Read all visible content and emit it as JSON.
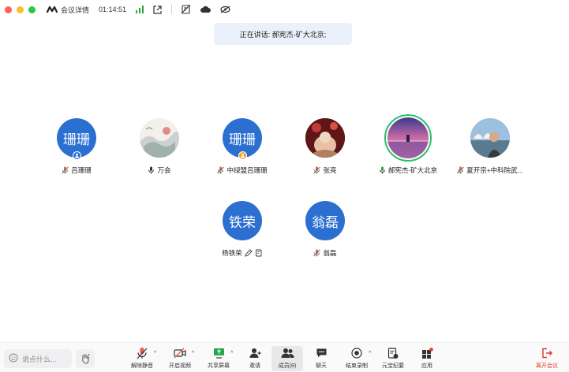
{
  "titlebar": {
    "meeting_info": "会议详情",
    "timer": "01:14:51"
  },
  "speaking_banner": "正在讲话: 郝宪杰-矿大北京;",
  "participants": [
    {
      "name": "吕珊珊",
      "avatar_text": "珊珊",
      "mic": "muted",
      "badge": "blue"
    },
    {
      "name": "万会",
      "avatar_text": "",
      "mic": "on",
      "badge": ""
    },
    {
      "name": "中绿盟吕珊珊",
      "avatar_text": "珊珊",
      "mic": "muted",
      "badge": "orange"
    },
    {
      "name": "张亮",
      "avatar_text": "",
      "mic": "muted",
      "badge": ""
    },
    {
      "name": "郝宪杰-矿大北京",
      "avatar_text": "",
      "mic": "speaking",
      "badge": ""
    },
    {
      "name": "夏开宗+中科院武...",
      "avatar_text": "",
      "mic": "muted",
      "badge": ""
    },
    {
      "name": "杨铁荣",
      "avatar_text": "铁荣",
      "mic": "none",
      "badge": ""
    },
    {
      "name": "翁磊",
      "avatar_text": "翁磊",
      "mic": "muted",
      "badge": ""
    }
  ],
  "toolbar": {
    "chat_placeholder": "说点什么...",
    "unmute": "解除静音",
    "video": "开启视频",
    "share": "共享屏幕",
    "invite": "邀请",
    "members": "成员(8)",
    "chat": "聊天",
    "record": "结束录制",
    "minutes": "元宝纪要",
    "apps": "应用",
    "leave": "离开会议"
  },
  "colors": {
    "avatar_blue": "#2b6fd0",
    "speaking_green": "#28c06a",
    "leave_red": "#e03c31",
    "banner_bg": "#ebf1fb"
  }
}
